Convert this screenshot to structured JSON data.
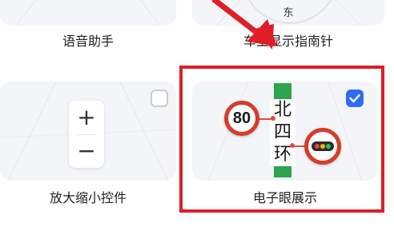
{
  "settings_grid": {
    "items": [
      {
        "label": "语音助手"
      },
      {
        "label": "车上显示指南针",
        "compass_text": "东"
      },
      {
        "label": "放大缩小控件",
        "zoom_in": "+",
        "zoom_out": "−",
        "checked": false
      },
      {
        "label": "电子眼展示",
        "checked": true,
        "road_chars": [
          "北",
          "四",
          "环"
        ],
        "speed_limit": "80"
      }
    ]
  },
  "colors": {
    "highlight": "#e11d27",
    "accent": "#2f6cf6",
    "road": "#2da44e",
    "sign_red": "#d43d2a"
  },
  "icons": {
    "annotation": "red-arrow-icon",
    "check": "check-icon",
    "traffic_light": "traffic-light-icon"
  }
}
